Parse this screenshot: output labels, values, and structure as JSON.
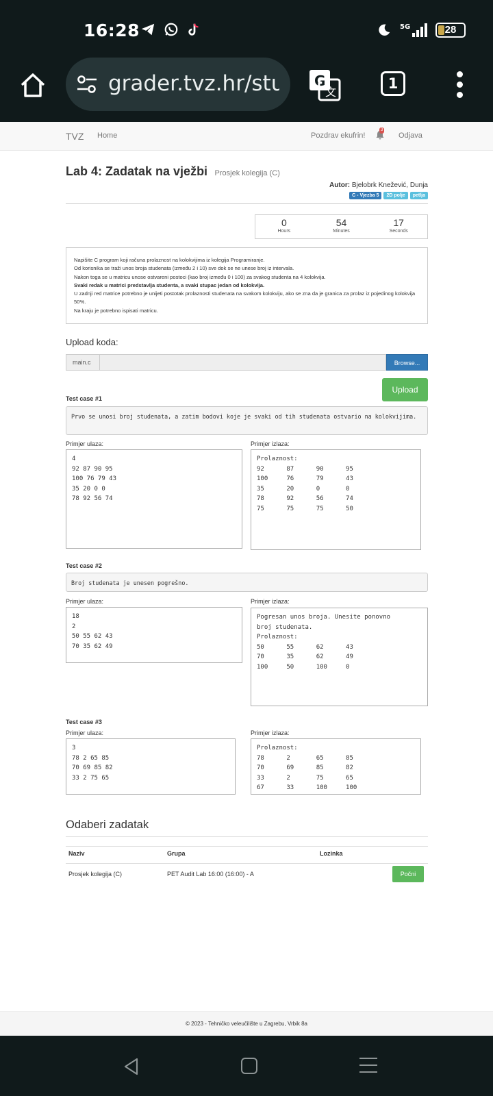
{
  "status_bar": {
    "time": "16:28",
    "battery": "28",
    "network": "5G",
    "left_icons": [
      "telegram-icon",
      "whatsapp-icon",
      "tiktok-icon"
    ],
    "right_icons": [
      "moon-icon",
      "signal-icon",
      "battery-icon"
    ]
  },
  "browser": {
    "url": "grader.tvz.hr/stud",
    "tab_count": "1"
  },
  "nav": {
    "brand": "TVZ",
    "home": "Home",
    "greeting": "Pozdrav ekufrin!",
    "notification_count": "3",
    "logout": "Odjava"
  },
  "page": {
    "title": "Lab 4: Zadatak na vježbi",
    "subtitle": "Prosjek kolegija (C)",
    "author_label": "Autor:",
    "author": "Bjelobrk Knežević, Dunja",
    "labels": [
      {
        "text": "C - Vjezba 5",
        "color": "#337ab7"
      },
      {
        "text": "2D polje",
        "color": "#5bc0de"
      },
      {
        "text": "petlja",
        "color": "#5bc0de"
      }
    ]
  },
  "timer": {
    "hours": "0",
    "hours_label": "Hours",
    "minutes": "54",
    "minutes_label": "Minutes",
    "seconds": "17",
    "seconds_label": "Seconds"
  },
  "description": {
    "line1": "Napišite C program koji računa prolaznost na kolokvijima iz kolegija Programiranje.",
    "line2": "Od korisnika se traži unos broja studenata (između 2 i 10) sve dok se ne unese broj iz intervala.",
    "line3": "Nakon toga se u matricu unose ostvareni postoci (kao broj između 0 i 100) za svakog studenta na 4 kolokvija.",
    "line4_bold": "Svaki redak u matrici predstavlja studenta, a svaki stupac jedan od kolokvija.",
    "line5": "U zadnji red matrice potrebno je unijeti postotak prolaznosti studenata na svakom kolokviju, ako se zna da je granica za prolaz iz pojedinog kolokvija 50%.",
    "line6": "Na kraju je potrebno ispisati matricu."
  },
  "upload": {
    "heading": "Upload koda:",
    "file_name": "main.c",
    "browse_label": "Browse...",
    "upload_label": "Upload"
  },
  "test_cases": [
    {
      "title": "Test case #1",
      "description": "Prvo se unosi broj studenata, a zatim bodovi koje je svaki od tih studenata ostvario na kolokvijima.",
      "input_label": "Primjer ulaza:",
      "output_label": "Primjer izlaza:",
      "input": "4\n92 87 90 95\n100 76 79 43\n35 20 0 0\n78 92 56 74",
      "output": "Prolaznost:\n92      87      90      95\n100     76      79      43\n35      20      0       0\n78      92      56      74\n75      75      75      50"
    },
    {
      "title": "Test case #2",
      "description": "Broj studenata je unesen pogrešno.",
      "input_label": "Primjer ulaza:",
      "output_label": "Primjer izlaza:",
      "input": "18\n2\n50 55 62 43\n70 35 62 49",
      "output": "Pogresan unos broja. Unesite ponovno\nbroj studenata.\nProlaznost:\n50      55      62      43\n70      35      62      49\n100     50      100     0"
    },
    {
      "title": "Test case #3",
      "input_label": "Primjer ulaza:",
      "output_label": "Primjer izlaza:",
      "input": "3\n78 2 65 85\n70 69 85 82\n33 2 75 65",
      "output": "Prolaznost:\n78      2       65      85\n70      69      85      82\n33      2       75      65\n67      33      100     100"
    }
  ],
  "choose": {
    "heading": "Odaberi zadatak",
    "columns": [
      "Naziv",
      "Grupa",
      "Lozinka"
    ],
    "row": {
      "name": "Prosjek kolegija (C)",
      "group": "PET Audit Lab 16:00 (16:00) - A",
      "password": "",
      "action": "Počni"
    }
  },
  "footer": {
    "text": "© 2023 - Tehničko veleučilište u Zagrebu, Vrbik 8a"
  }
}
